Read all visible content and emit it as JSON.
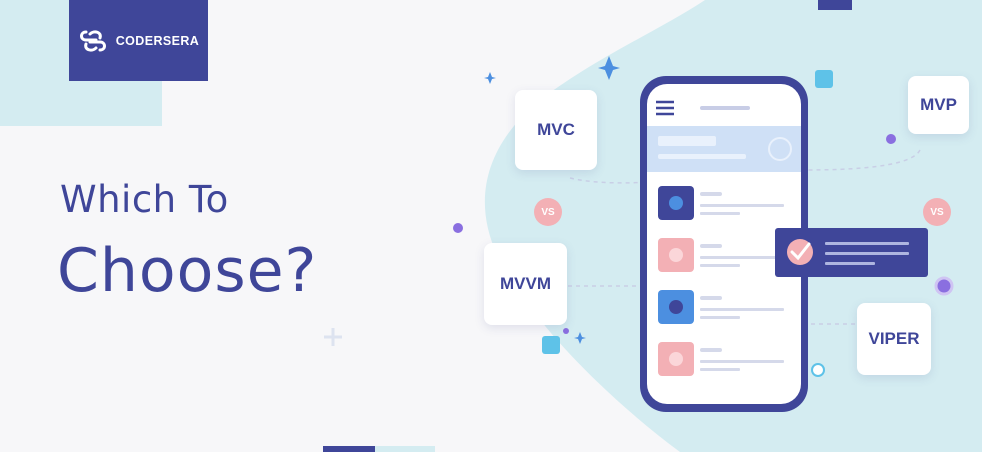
{
  "brand": {
    "name": "CODERSERA",
    "logo_icon": "codersera-logo-icon"
  },
  "headline": {
    "line1": "Which To",
    "line2": "Choose?"
  },
  "architectures": {
    "mvc": "MVC",
    "mvp": "MVP",
    "mvvm": "MVVM",
    "viper": "VIPER"
  },
  "vs_label": "VS",
  "colors": {
    "primary": "#3f4699",
    "light_blue_bg": "#d4ecf1",
    "pink": "#f3b0b5",
    "accent_blue": "#4c8fe0",
    "cyan": "#5ec2e8"
  }
}
